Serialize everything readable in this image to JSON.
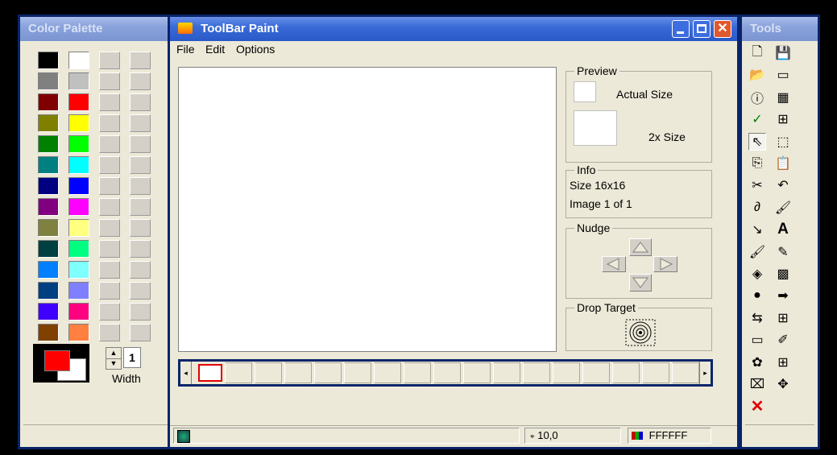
{
  "palette_window": {
    "title": "Color Palette",
    "colors": [
      "#000000",
      "#ffffff",
      "#808080",
      "#c0c0c0",
      "#800000",
      "#ff0000",
      "#808000",
      "#ffff00",
      "#008000",
      "#00ff00",
      "#008080",
      "#00ffff",
      "#000080",
      "#0000ff",
      "#800080",
      "#ff00ff",
      "#808040",
      "#ffff80",
      "#004040",
      "#00ff80",
      "#0080ff",
      "#80ffff",
      "#004080",
      "#8080ff",
      "#4000ff",
      "#ff0080",
      "#804000",
      "#ff8040"
    ],
    "foreground_color": "#ff0000",
    "background_color": "#ffffff",
    "width_label": "Width",
    "width_value": "1"
  },
  "main_window": {
    "title": "ToolBar Paint",
    "menu": [
      "File",
      "Edit",
      "Options"
    ],
    "preview": {
      "label": "Preview",
      "actual_size": "Actual Size",
      "double_size": "2x Size"
    },
    "info": {
      "label": "Info",
      "size": "Size 16x16",
      "image": "Image 1 of 1"
    },
    "nudge_label": "Nudge",
    "drop_target_label": "Drop Target",
    "status": {
      "cursor_pos": "10,0",
      "color_hex": "FFFFFF"
    },
    "filmstrip_cells": 17
  },
  "tools_window": {
    "title": "Tools",
    "icons": [
      "new-icon",
      "save-icon",
      "open-icon",
      "window-icon",
      "info-icon",
      "palette-grid-icon",
      "check-icon",
      "grid-icon",
      "pointer-icon",
      "selection-icon",
      "copy-icon",
      "paste-icon",
      "cut-icon",
      "undo-icon",
      "lasso-icon",
      "brush-icon",
      "line-icon",
      "text-icon",
      "paint-brush-icon",
      "eraser-icon",
      "fill-icon",
      "gradient-icon",
      "shapes-icon",
      "export-icon",
      "swap-icon",
      "resize-icon",
      "rectangle-icon",
      "color-picker-icon",
      "rgb-icon",
      "add-icon",
      "text-box-icon",
      "move-icon",
      "delete-icon"
    ],
    "glyphs": [
      "🗋",
      "💾",
      "📂",
      "▭",
      "ⓘ",
      "▦",
      "✓",
      "⊞",
      "⇖",
      "⬚",
      "⎘",
      "📋",
      "✂",
      "↶",
      "∂",
      "🖌",
      "↘",
      "A",
      "🖌",
      "✎",
      "◈",
      "▩",
      "●",
      "➡",
      "⇆",
      "⊞",
      "▭",
      "✐",
      "✿",
      "⊞",
      "⌧",
      "✥",
      "✕"
    ],
    "colors": {
      "check": "#008000",
      "delete": "#e00000"
    }
  }
}
